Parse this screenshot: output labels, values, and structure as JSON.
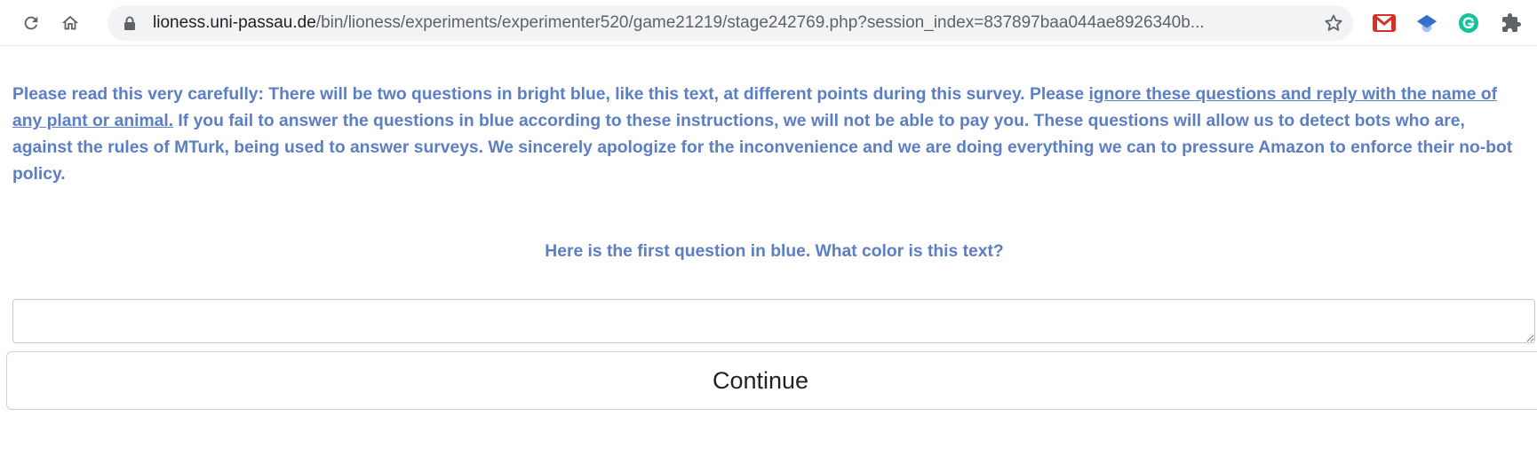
{
  "browser": {
    "url_domain": "lioness.uni-passau.de",
    "url_path": "/bin/lioness/experiments/experimenter520/game21219/stage242769.php?session_index=837897baa044ae8926340b..."
  },
  "survey": {
    "warning_part1": "Please read this very carefully: There will be two questions in bright blue, like this text, at different points during this survey. Please ",
    "warning_underlined": "ignore these questions and reply with the name of any plant or animal.",
    "warning_part2": " If you fail to answer the questions in blue according to these instructions, we will not be able to pay you. These questions will allow us to detect bots who are, against the rules of MTurk, being used to answer surveys. We sincerely apologize for the inconvenience and we are doing everything we can to pressure Amazon to enforce their no-bot policy.",
    "question": "Here is the first question in blue. What color is this text?",
    "answer_value": "",
    "continue_label": "Continue"
  },
  "colors": {
    "question_text": "#5b7ec4",
    "gmail_red": "#d93025",
    "grammarly_green": "#15c39a",
    "scholar_blue": "#4285f4"
  },
  "icons": [
    "reload-icon",
    "home-icon",
    "lock-icon",
    "star-icon",
    "gmail-icon",
    "scholar-icon",
    "grammarly-icon",
    "extensions-icon"
  ]
}
